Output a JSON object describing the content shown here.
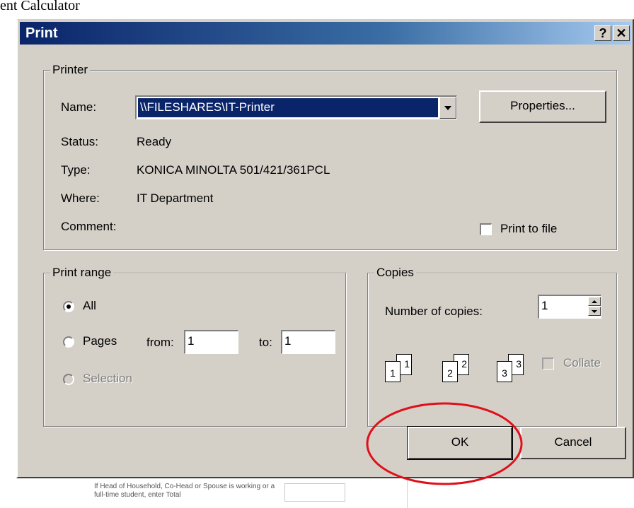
{
  "background": {
    "title_partial": "ent Calculator",
    "footnote": "If Head of Household, Co-Head or Spouse is working or a full-time student, enter Total"
  },
  "dialog": {
    "title": "Print",
    "help_button": "?",
    "close_button": "✕"
  },
  "printer": {
    "group_title": "Printer",
    "name_label": "Name:",
    "name_value": "\\\\FILESHARES\\IT-Printer",
    "properties_button": "Properties...",
    "status_label": "Status:",
    "status_value": "Ready",
    "type_label": "Type:",
    "type_value": "KONICA MINOLTA 501/421/361PCL",
    "where_label": "Where:",
    "where_value": "IT Department",
    "comment_label": "Comment:",
    "print_to_file_label": "Print to file",
    "print_to_file_checked": false
  },
  "print_range": {
    "group_title": "Print range",
    "all_label": "All",
    "pages_label": "Pages",
    "from_label": "from:",
    "from_value": "1",
    "to_label": "to:",
    "to_value": "1",
    "selection_label": "Selection",
    "selected": "All"
  },
  "copies": {
    "group_title": "Copies",
    "number_label": "Number of copies:",
    "number_value": "1",
    "collate_label": "Collate",
    "collate_checked": false,
    "page_icons": [
      "1",
      "1",
      "2",
      "2",
      "3",
      "3"
    ]
  },
  "buttons": {
    "ok": "OK",
    "cancel": "Cancel"
  },
  "annotation": {
    "highlight_color": "#e0101a",
    "target": "OK"
  }
}
